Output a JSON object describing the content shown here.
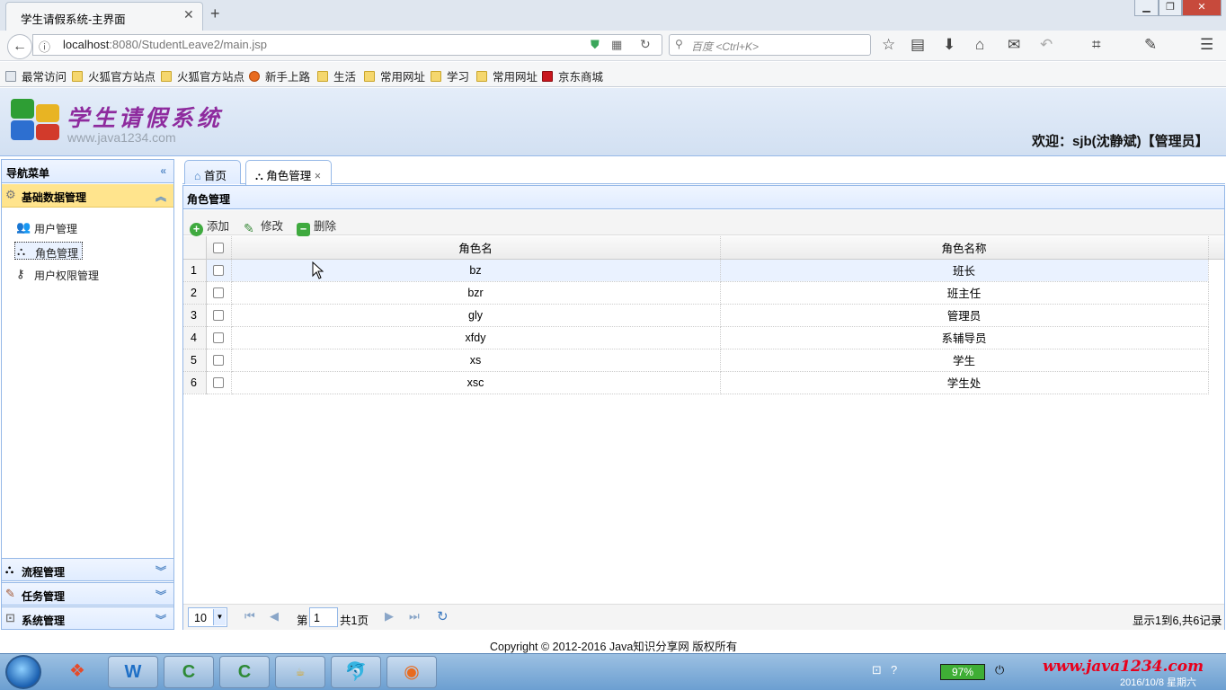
{
  "browser": {
    "tab_title": "学生请假系统-主界面",
    "tab_close": "✕",
    "new_tab": "+",
    "url_host": "localhost",
    "url_path": ":8080/StudentLeave2/main.jsp",
    "search_placeholder": "百度 <Ctrl+K>",
    "bookmarks": [
      "最常访问",
      "火狐官方站点",
      "火狐官方站点",
      "新手上路",
      "生活",
      "常用网址",
      "学习",
      "常用网址",
      "京东商城"
    ]
  },
  "app": {
    "title": "学生请假系统",
    "subtitle": "www.java1234.com",
    "welcome": "欢迎：sjb(沈静斌)【管理员】"
  },
  "sidebar": {
    "title": "导航菜单",
    "sections": [
      {
        "label": "基础数据管理",
        "items": [
          "用户管理",
          "角色管理",
          "用户权限管理"
        ]
      },
      {
        "label": "流程管理"
      },
      {
        "label": "任务管理"
      },
      {
        "label": "系统管理"
      }
    ]
  },
  "tabs": [
    {
      "label": "首页"
    },
    {
      "label": "角色管理",
      "close": "×"
    }
  ],
  "main": {
    "panel_title": "角色管理",
    "toolbar": {
      "add": "添加",
      "edit": "修改",
      "delete": "删除"
    },
    "columns": [
      "角色名",
      "角色名称"
    ],
    "rows": [
      {
        "n": "1",
        "name": "bz",
        "title": "班长"
      },
      {
        "n": "2",
        "name": "bzr",
        "title": "班主任"
      },
      {
        "n": "3",
        "name": "gly",
        "title": "管理员"
      },
      {
        "n": "4",
        "name": "xfdy",
        "title": "系辅导员"
      },
      {
        "n": "5",
        "name": "xs",
        "title": "学生"
      },
      {
        "n": "6",
        "name": "xsc",
        "title": "学生处"
      }
    ],
    "pager": {
      "page_size": "10",
      "page_label": "第",
      "page_value": "1",
      "total_pages": "共1页",
      "info": "显示1到6,共6记录"
    }
  },
  "footer": {
    "copyright": "Copyright © 2012-2016 Java知识分享网 版权所有"
  },
  "taskbar": {
    "battery": "97%",
    "watermark": "www.java1234.com",
    "date": "2016/10/8 星期六"
  },
  "colors": {
    "accent": "#95b8e7",
    "panel_header": "#e0ecff",
    "selected_section": "#ffe48d",
    "title_purple": "#8e2b9e"
  }
}
